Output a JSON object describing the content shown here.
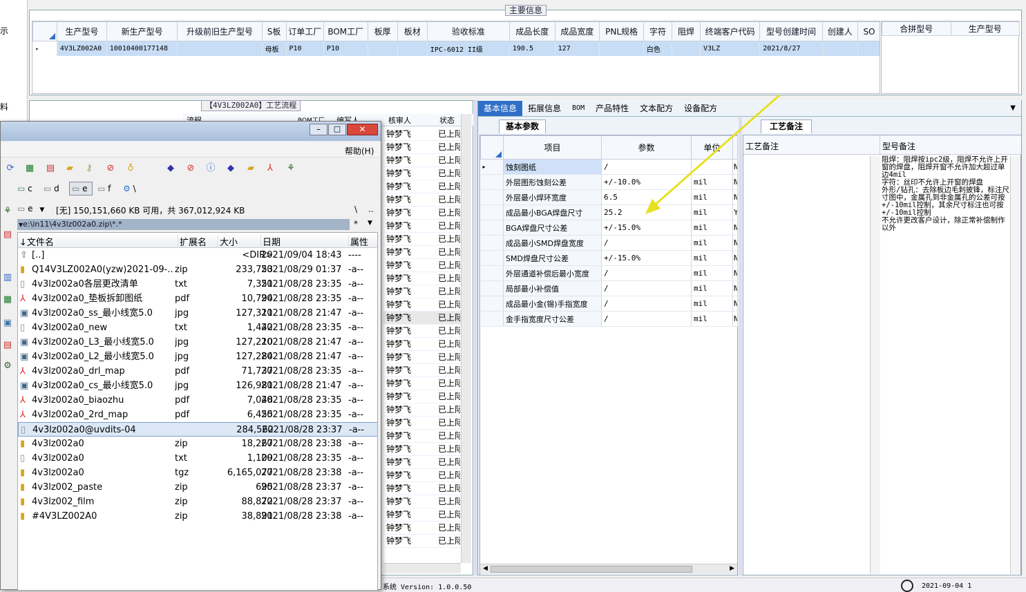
{
  "left_sidebar": {
    "items": [
      "示",
      "料"
    ]
  },
  "main_info": {
    "legend": "主要信息",
    "columns": [
      "生产型号",
      "新生产型号",
      "升级前旧生产型号",
      "S板",
      "订单工厂",
      "BOM工厂",
      "板厚",
      "板材",
      "验收标准",
      "成品长度",
      "成品宽度",
      "PNL规格",
      "字符",
      "阻焊",
      "终端客户代码",
      "型号创建时间",
      "创建人",
      "SO"
    ],
    "row": [
      "4V3LZ002A0",
      "10010400177148",
      "",
      "母板",
      "P10",
      "P10",
      "",
      "",
      "IPC-6012 II级",
      "190.5",
      "127",
      "",
      "白色",
      "",
      "V3LZ",
      "2021/8/27",
      "",
      ""
    ],
    "merge_columns": [
      "合拼型号",
      "生产型号"
    ]
  },
  "process": {
    "legend": "【4V3LZ002A0】工艺流程",
    "columns": [
      "流程",
      "BOM工厂",
      "编写人",
      "核审人",
      "状态"
    ],
    "reviewer": "钟梦飞",
    "status": "已上际",
    "row_count": 32
  },
  "detail_tabs": {
    "items": [
      "基本信息",
      "拓展信息",
      "BOM",
      "产品特性",
      "文本配方",
      "设备配方"
    ],
    "active": 0
  },
  "basic_params": {
    "tab": "基本参数",
    "columns": [
      "项目",
      "参数",
      "单位"
    ],
    "rows": [
      {
        "item": "蚀刻图纸",
        "value": "/",
        "unit": "",
        "flag": "N"
      },
      {
        "item": "外层图形蚀刻公差",
        "value": "+/-10.0%",
        "unit": "mil",
        "flag": "N"
      },
      {
        "item": "外层最小焊环宽度",
        "value": "6.5",
        "unit": "mil",
        "flag": "N"
      },
      {
        "item": "成品最小BGA焊盘尺寸",
        "value": "25.2",
        "unit": "mil",
        "flag": "Y"
      },
      {
        "item": "BGA焊盘尺寸公差",
        "value": "+/-15.0%",
        "unit": "mil",
        "flag": "N"
      },
      {
        "item": "成品最小SMD焊盘宽度",
        "value": "/",
        "unit": "mil",
        "flag": "N"
      },
      {
        "item": "SMD焊盘尺寸公差",
        "value": "+/-15.0%",
        "unit": "mil",
        "flag": "N"
      },
      {
        "item": "外层通道补偿后最小宽度",
        "value": "/",
        "unit": "mil",
        "flag": "N"
      },
      {
        "item": "局部最小补偿值",
        "value": "/",
        "unit": "mil",
        "flag": "N"
      },
      {
        "item": "成品最小金(锡)手指宽度",
        "value": "/",
        "unit": "mil",
        "flag": "N"
      },
      {
        "item": "金手指宽度尺寸公差",
        "value": "/",
        "unit": "mil",
        "flag": "N"
      }
    ]
  },
  "craft_notes": {
    "tab": "工艺备注",
    "col1": "工艺备注",
    "col2": "型号备注",
    "note": "阻焊：阻焊按ipc2级，阻焊不允许上开窗的焊盘，阻焊开窗不允许加大超过单边4mil\n字符：丝印不允许上开窗的焊盘\n外形/钻孔：去除板边毛刺披锋，标注尺寸图中，金属孔到非金属孔的公差可按+/-10mil控制，其余尺寸标注也可按+/-10mil控制\n不允许更改客户设计，除正常补偿制作以外"
  },
  "status_bar": {
    "version": "系统 Version: 1.0.0.50",
    "date": "2021-09-04 1"
  },
  "file_manager": {
    "title": "",
    "help_menu": "帮助(H)",
    "drive_label": "e",
    "free_space": "[无] 150,151,660 KB 可用，共 367,012,924 KB",
    "path": "e:\\in11\\4v3lz002a0.zip\\*.*",
    "filter": "*",
    "drives": [
      "c",
      "d",
      "e",
      "f",
      "\\"
    ],
    "columns": [
      "文件名",
      "扩展名",
      "大小",
      "日期",
      "属性"
    ],
    "files": [
      {
        "name": "[..]",
        "ext": "",
        "size": "<DIR>",
        "date": "2021/09/04 18:43",
        "attr": "----",
        "type": "up"
      },
      {
        "name": "Q14V3LZ002A0(yzw)2021-09-..",
        "ext": "zip",
        "size": "233,753",
        "date": "2021/08/29 01:37",
        "attr": "-a--",
        "type": "zip"
      },
      {
        "name": "4v3lz002a0各层更改清单",
        "ext": "txt",
        "size": "7,351",
        "date": "2021/08/28 23:35",
        "attr": "-a--",
        "type": "txt"
      },
      {
        "name": "4v3lz002a0_垫板拆卸图纸",
        "ext": "pdf",
        "size": "10,794",
        "date": "2021/08/28 23:35",
        "attr": "-a--",
        "type": "pdf"
      },
      {
        "name": "4v3lz002a0_ss_最小线宽5.0",
        "ext": "jpg",
        "size": "127,311",
        "date": "2021/08/28 21:47",
        "attr": "-a--",
        "type": "img"
      },
      {
        "name": "4v3lz002a0_new",
        "ext": "txt",
        "size": "1,442",
        "date": "2021/08/28 23:35",
        "attr": "-a--",
        "type": "txt"
      },
      {
        "name": "4v3lz002a0_L3_最小线宽5.0",
        "ext": "jpg",
        "size": "127,210",
        "date": "2021/08/28 21:47",
        "attr": "-a--",
        "type": "img"
      },
      {
        "name": "4v3lz002a0_L2_最小线宽5.0",
        "ext": "jpg",
        "size": "127,284",
        "date": "2021/08/28 21:47",
        "attr": "-a--",
        "type": "img"
      },
      {
        "name": "4v3lz002a0_drl_map",
        "ext": "pdf",
        "size": "71,737",
        "date": "2021/08/28 23:35",
        "attr": "-a--",
        "type": "pdf"
      },
      {
        "name": "4v3lz002a0_cs_最小线宽5.0",
        "ext": "jpg",
        "size": "126,981",
        "date": "2021/08/28 21:47",
        "attr": "-a--",
        "type": "img"
      },
      {
        "name": "4v3lz002a0_biaozhu",
        "ext": "pdf",
        "size": "7,048",
        "date": "2021/08/28 23:35",
        "attr": "-a--",
        "type": "pdf"
      },
      {
        "name": "4v3lz002a0_2rd_map",
        "ext": "pdf",
        "size": "6,455",
        "date": "2021/08/28 23:35",
        "attr": "-a--",
        "type": "pdf"
      },
      {
        "name": "4v3lz002a0@uvdits-04",
        "ext": "",
        "size": "284,562",
        "date": "2021/08/28 23:37",
        "attr": "-a--",
        "type": "txt"
      },
      {
        "name": "4v3lz002a0",
        "ext": "zip",
        "size": "18,267",
        "date": "2021/08/28 23:38",
        "attr": "-a--",
        "type": "zip"
      },
      {
        "name": "4v3lz002a0",
        "ext": "txt",
        "size": "1,109",
        "date": "2021/08/28 23:35",
        "attr": "-a--",
        "type": "txt"
      },
      {
        "name": "4v3lz002a0",
        "ext": "tgz",
        "size": "6,165,077",
        "date": "2021/08/28 23:38",
        "attr": "-a--",
        "type": "zip"
      },
      {
        "name": "4v3lz002_paste",
        "ext": "zip",
        "size": "695",
        "date": "2021/08/28 23:37",
        "attr": "-a--",
        "type": "zip"
      },
      {
        "name": "4v3lz002_film",
        "ext": "zip",
        "size": "88,872",
        "date": "2021/08/28 23:37",
        "attr": "-a--",
        "type": "zip"
      },
      {
        "name": "#4V3LZ002A0",
        "ext": "zip",
        "size": "38,891",
        "date": "2021/08/28 23:38",
        "attr": "-a--",
        "type": "zip"
      }
    ],
    "selected_index": 12
  },
  "colors": {
    "accent": "#2f6ec7",
    "arrow": "#e8e020",
    "selection": "#c7ddf5"
  }
}
